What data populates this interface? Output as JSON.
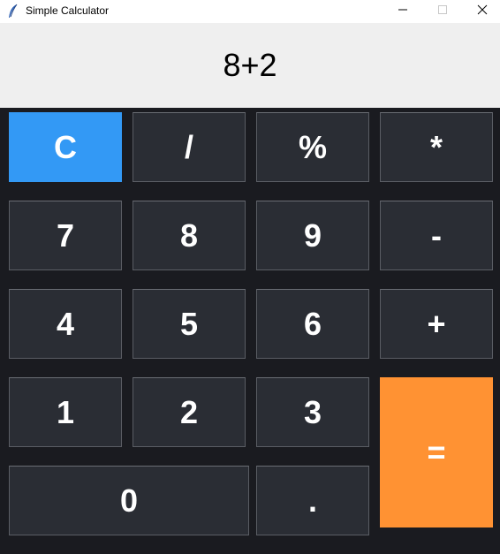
{
  "window": {
    "title": "Simple Calculator",
    "controls": {
      "minimize_icon": "minimize-icon",
      "maximize_icon": "maximize-icon",
      "close_icon": "close-icon"
    }
  },
  "display": {
    "expression": "8+2"
  },
  "keypad": {
    "clear": "C",
    "divide": "/",
    "percent": "%",
    "multiply": "*",
    "seven": "7",
    "eight": "8",
    "nine": "9",
    "minus": "-",
    "four": "4",
    "five": "5",
    "six": "6",
    "plus": "+",
    "one": "1",
    "two": "2",
    "three": "3",
    "equals": "=",
    "zero": "0",
    "decimal": "."
  },
  "colors": {
    "background": "#1a1b20",
    "key": "#2a2d34",
    "clear_accent": "#3399f5",
    "equals_accent": "#ff9233",
    "display_bg": "#efefef"
  }
}
